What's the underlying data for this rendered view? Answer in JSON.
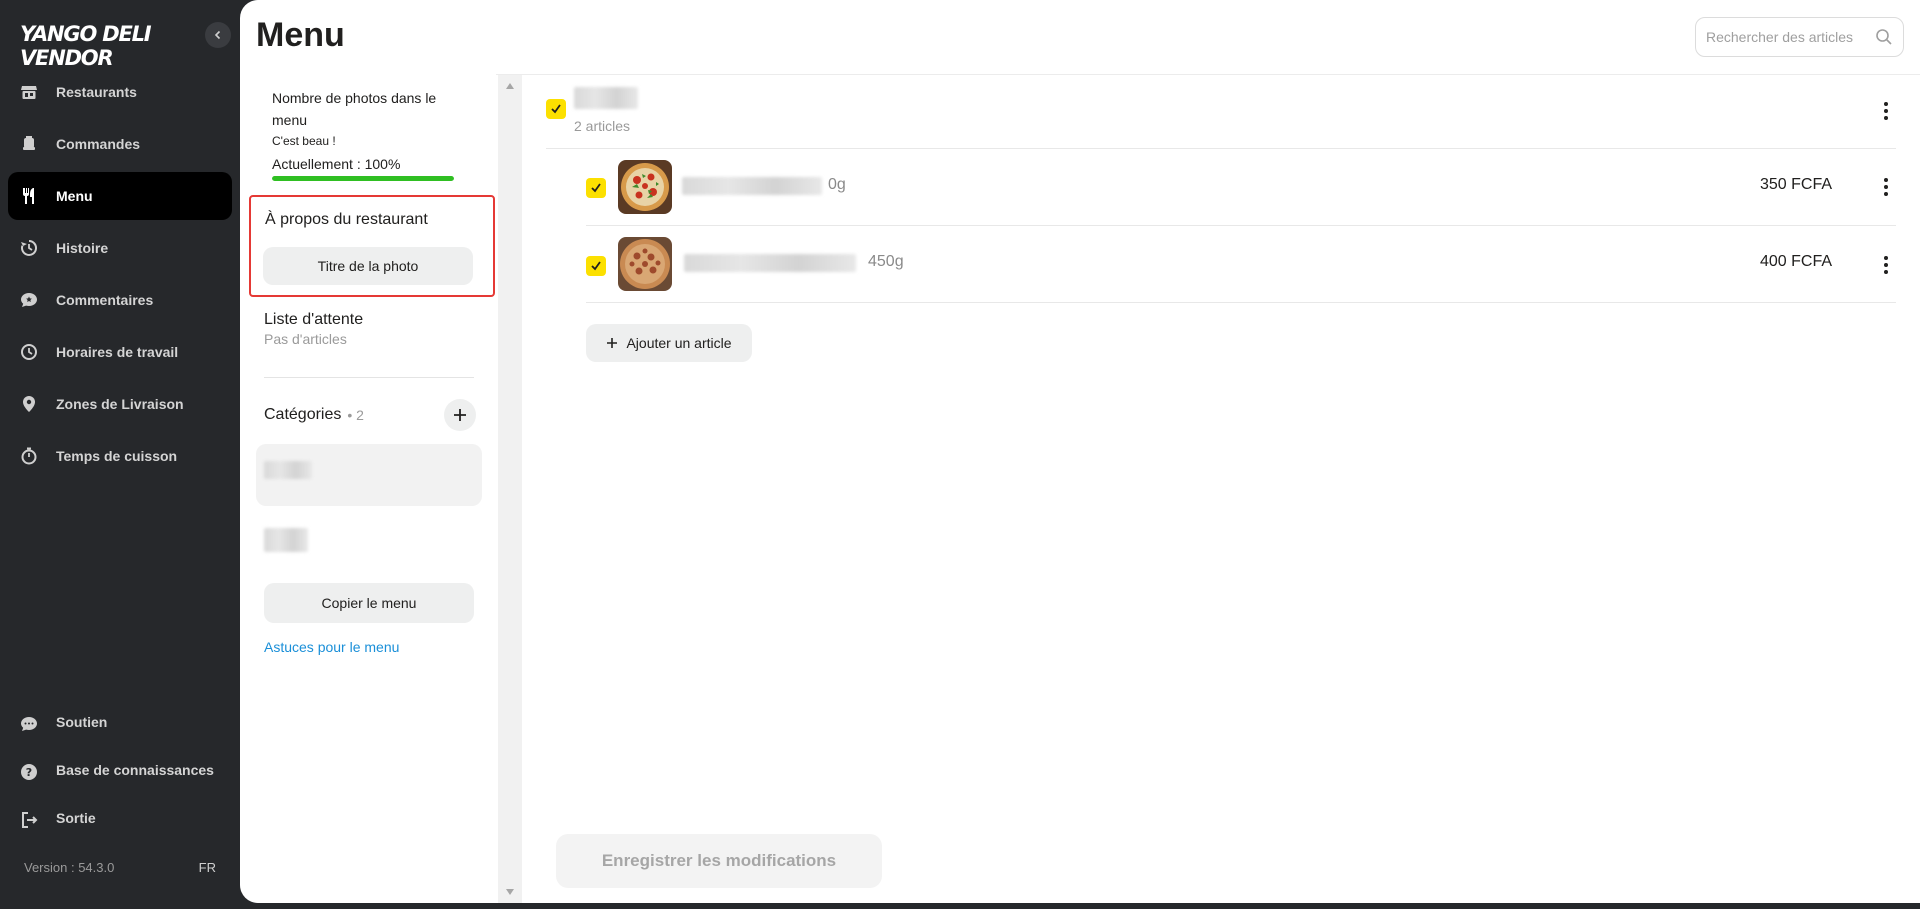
{
  "brand": {
    "name": "YANGO DELI VENDOR"
  },
  "sidebar": {
    "items": [
      {
        "label": "Restaurants",
        "icon": "store-icon"
      },
      {
        "label": "Commandes",
        "icon": "bell-icon"
      },
      {
        "label": "Menu",
        "icon": "cutlery-icon",
        "active": true
      },
      {
        "label": "Histoire",
        "icon": "history-icon"
      },
      {
        "label": "Commentaires",
        "icon": "comment-icon"
      },
      {
        "label": "Horaires de travail",
        "icon": "clock-icon"
      },
      {
        "label": "Zones de Livraison",
        "icon": "location-pin-icon"
      },
      {
        "label": "Temps de cuisson",
        "icon": "timer-icon"
      }
    ],
    "bottom_items": [
      {
        "label": "Soutien",
        "icon": "chat-icon"
      },
      {
        "label": "Base de connaissances",
        "icon": "help-icon"
      },
      {
        "label": "Sortie",
        "icon": "logout-icon"
      }
    ],
    "version": "Version : 54.3.0",
    "language": "FR"
  },
  "header": {
    "title": "Menu",
    "search_placeholder": "Rechercher des articles"
  },
  "left_panel": {
    "photo_stats": {
      "title": "Nombre de photos dans le menu",
      "subtitle": "C'est beau !",
      "current": "Actuellement : 100%",
      "progress_percent": 100
    },
    "about": {
      "title": "À propos du restaurant",
      "button": "Titre de la photo"
    },
    "waitlist": {
      "title": "Liste d'attente",
      "subtitle": "Pas d'articles"
    },
    "categories": {
      "title": "Catégories",
      "count": "• 2"
    },
    "copy_button": "Copier le menu",
    "tips_link": "Astuces pour le menu"
  },
  "content": {
    "category": {
      "count": "2 articles"
    },
    "items": [
      {
        "weight": "0g",
        "price": "350 FCFA"
      },
      {
        "weight": "450g",
        "price": "400 FCFA"
      }
    ],
    "add_item_button": "Ajouter un article",
    "save_button": "Enregistrer les modifications"
  },
  "colors": {
    "accent_yellow": "#fce000",
    "progress_green": "#2fbf22",
    "highlight_red": "#e53935",
    "link_blue": "#1a8fd8",
    "sidebar_bg": "#26282b"
  }
}
